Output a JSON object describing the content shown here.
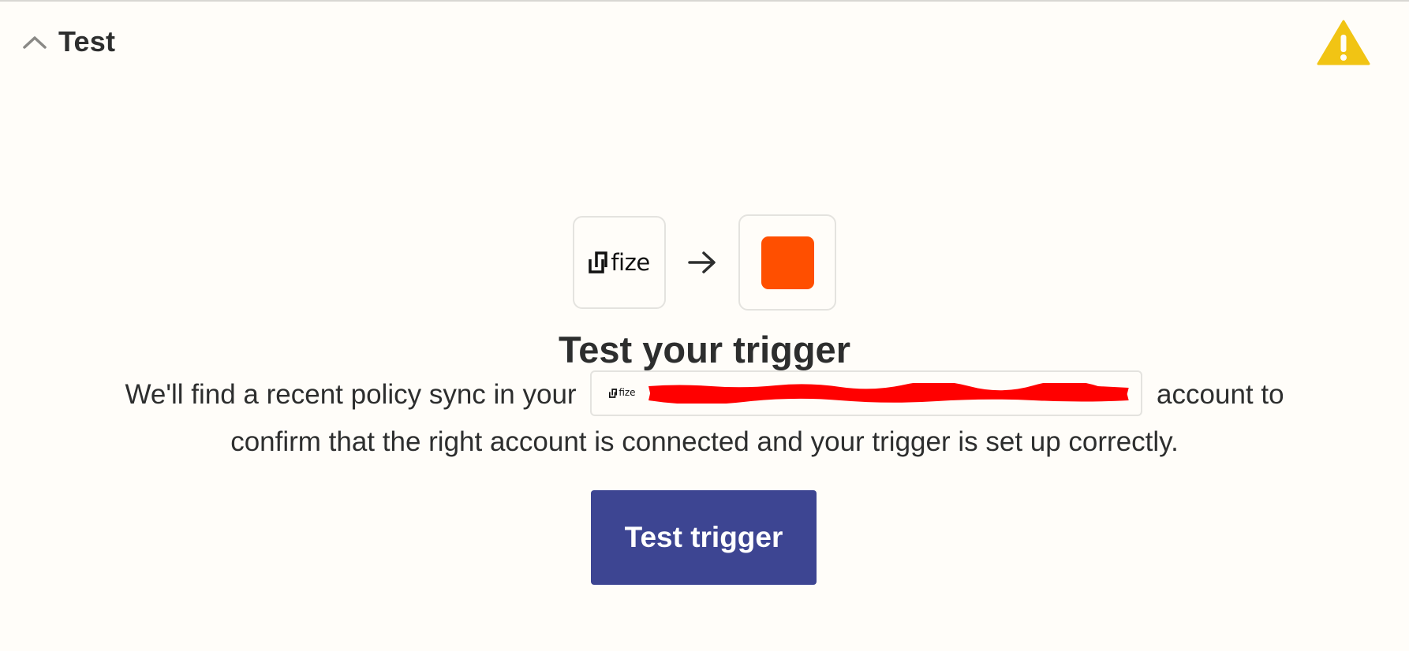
{
  "section": {
    "title": "Test",
    "expanded_icon": "chevron-up-icon",
    "status_icon": "warning-triangle-icon",
    "status_color": "#f1c40f"
  },
  "apps": {
    "source": {
      "name": "fize",
      "icon": "fize-logo"
    },
    "connector_icon": "arrow-right-icon",
    "target": {
      "icon": "orange-square-app-icon",
      "color": "#ff4f00"
    }
  },
  "main": {
    "title": "Test your trigger",
    "desc_before": "We'll find a recent policy sync in your",
    "account_app": "fize",
    "desc_after": "account to confirm that the right account is connected and your trigger is set up correctly.",
    "button_label": "Test trigger",
    "button_color": "#3d4592"
  }
}
